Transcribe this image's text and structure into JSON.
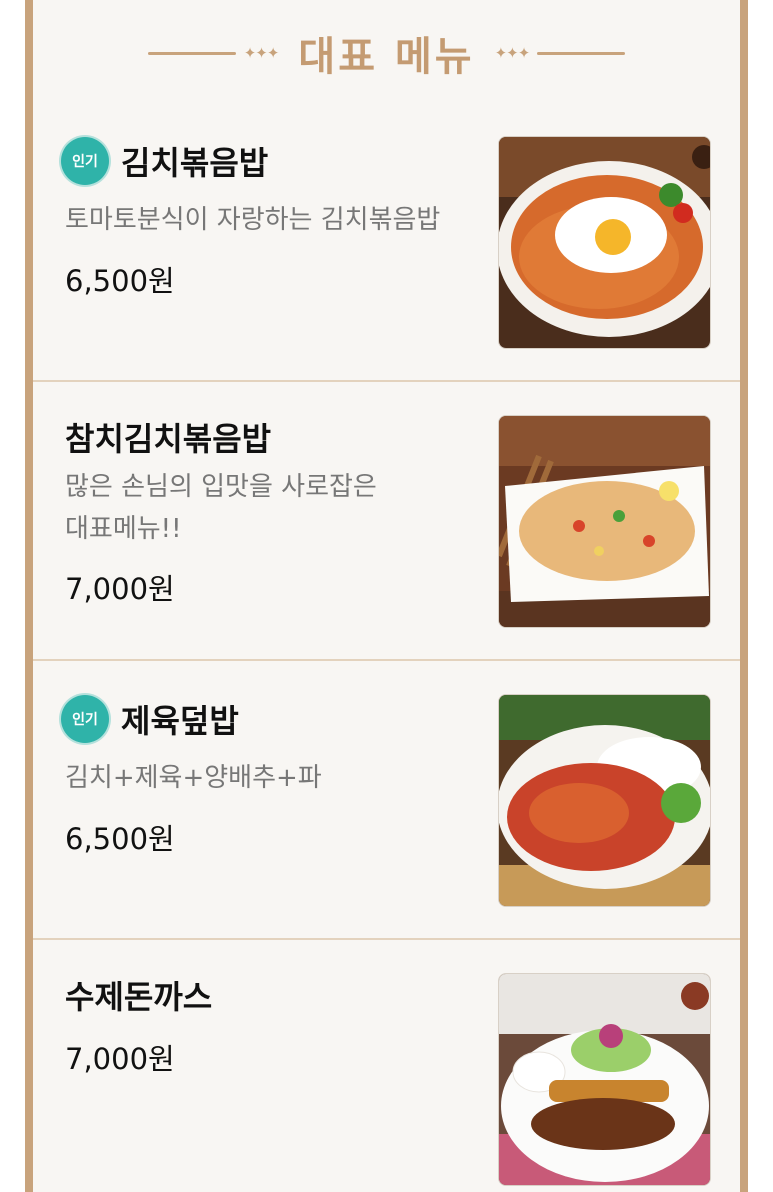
{
  "header": {
    "title": "대표 메뉴",
    "left_ornament": "✦✦✦",
    "right_ornament": "✦✦✦"
  },
  "colors": {
    "accent": "#c8a37c",
    "badge": "#2fb3a9",
    "divider": "#e3d2bd"
  },
  "menu": [
    {
      "badge": "인기",
      "name": "김치볶음밥",
      "description": "토마토분식이 자랑하는 김치볶음밥",
      "price": "6,500원",
      "image_icon": "kimchi-fried-rice-photo"
    },
    {
      "badge": "",
      "name": "참치김치볶음밥",
      "description_line1": "많은 손님의 입맛을 사로잡은",
      "description_line2": "대표메뉴!!",
      "price": "7,000원",
      "image_icon": "tuna-kimchi-fried-rice-photo"
    },
    {
      "badge": "인기",
      "name": "제육덮밥",
      "description": "김치+제육+양배추+파",
      "price": "6,500원",
      "image_icon": "spicy-pork-rice-bowl-photo"
    },
    {
      "badge": "",
      "name": "수제돈까스",
      "price": "7,000원",
      "image_icon": "handmade-pork-cutlet-photo"
    }
  ]
}
